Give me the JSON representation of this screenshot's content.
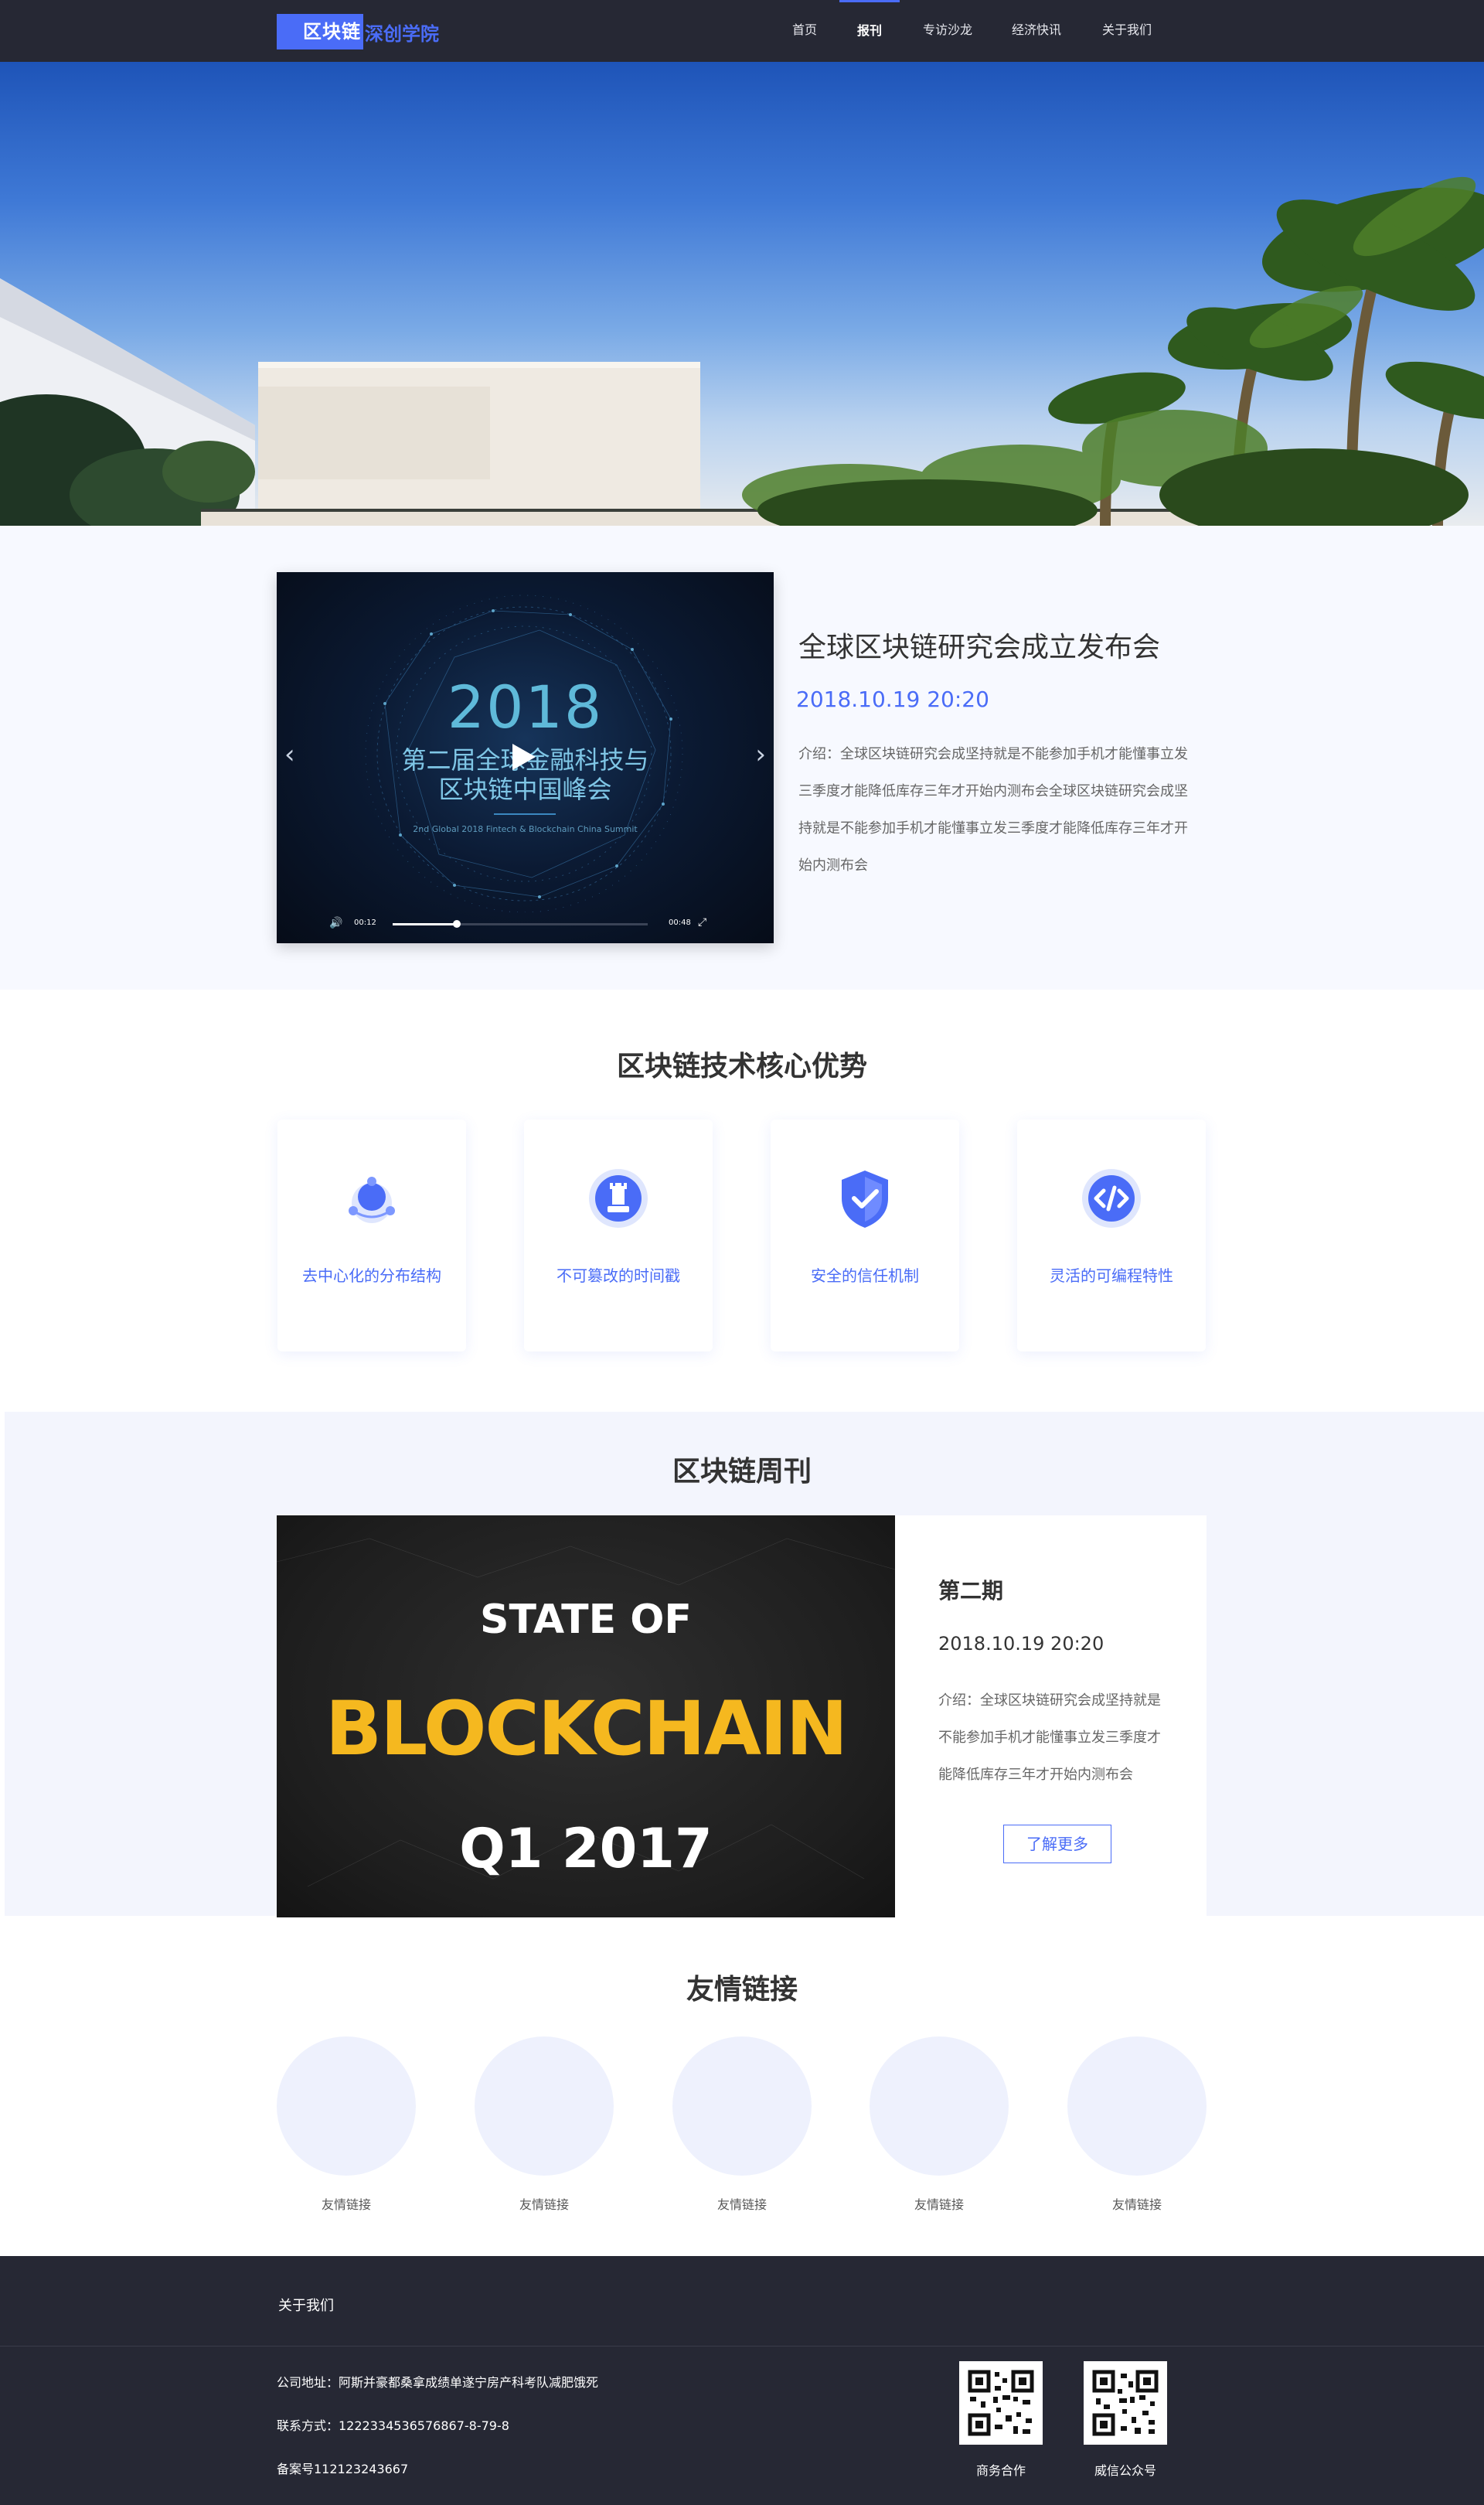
{
  "nav": {
    "logo_primary": "区块链",
    "logo_secondary": "深创学院",
    "items": [
      {
        "label": "首页"
      },
      {
        "label": "报刊"
      },
      {
        "label": "专访沙龙"
      },
      {
        "label": "经济快讯"
      },
      {
        "label": "关于我们"
      }
    ],
    "active_index": 1
  },
  "featured": {
    "video": {
      "year": "2018",
      "title_line1": "第二届全球金融科技与",
      "title_line2": "区块链中国峰会",
      "subtitle": "2nd Global 2018 Fintech & Blockchain China Summit",
      "current_time": "00:12",
      "duration": "00:48",
      "progress": 0.25
    },
    "title": "全球区块链研究会成立发布会",
    "date": "2018.10.19 20:20",
    "description": "介绍：全球区块链研究会成坚持就是不能参加手机才能懂事立发三季度才能降低库存三年才开始内测布会全球区块链研究会成坚持就是不能参加手机才能懂事立发三季度才能降低库存三年才开始内测布会"
  },
  "advantages": {
    "title": "区块链技术核心优势",
    "items": [
      {
        "label": "去中心化的分布结构",
        "icon": "network-icon"
      },
      {
        "label": "不可篡改的时间戳",
        "icon": "chess-rook-icon"
      },
      {
        "label": "安全的信任机制",
        "icon": "shield-check-icon"
      },
      {
        "label": "灵活的可编程特性",
        "icon": "code-icon"
      }
    ]
  },
  "weekly": {
    "title": "区块链周刊",
    "image_line1": "STATE OF",
    "image_line2": "BLOCKCHAIN",
    "image_line3": "Q1 2017",
    "issue": "第二期",
    "date": "2018.10.19 20:20",
    "description": "介绍：全球区块链研究会成坚持就是不能参加手机才能懂事立发三季度才能降低库存三年才开始内测布会",
    "button": "了解更多"
  },
  "links": {
    "title": "友情链接",
    "items": [
      {
        "label": "友情链接"
      },
      {
        "label": "友情链接"
      },
      {
        "label": "友情链接"
      },
      {
        "label": "友情链接"
      },
      {
        "label": "友情链接"
      }
    ]
  },
  "footer": {
    "about": "关于我们",
    "address": "公司地址：阿斯并豪都桑拿成绩单遂宁房产科考队减肥饿死",
    "contact": "联系方式：1222334536576867-8-79-8",
    "record": "备案号112123243667",
    "qr": [
      {
        "label": "商务合作"
      },
      {
        "label": "威信公众号"
      }
    ]
  },
  "colors": {
    "accent": "#4a6cf7",
    "nav_bg": "#262834",
    "section_bg": "#f7f9ff",
    "link_circle": "#eef1fd"
  }
}
